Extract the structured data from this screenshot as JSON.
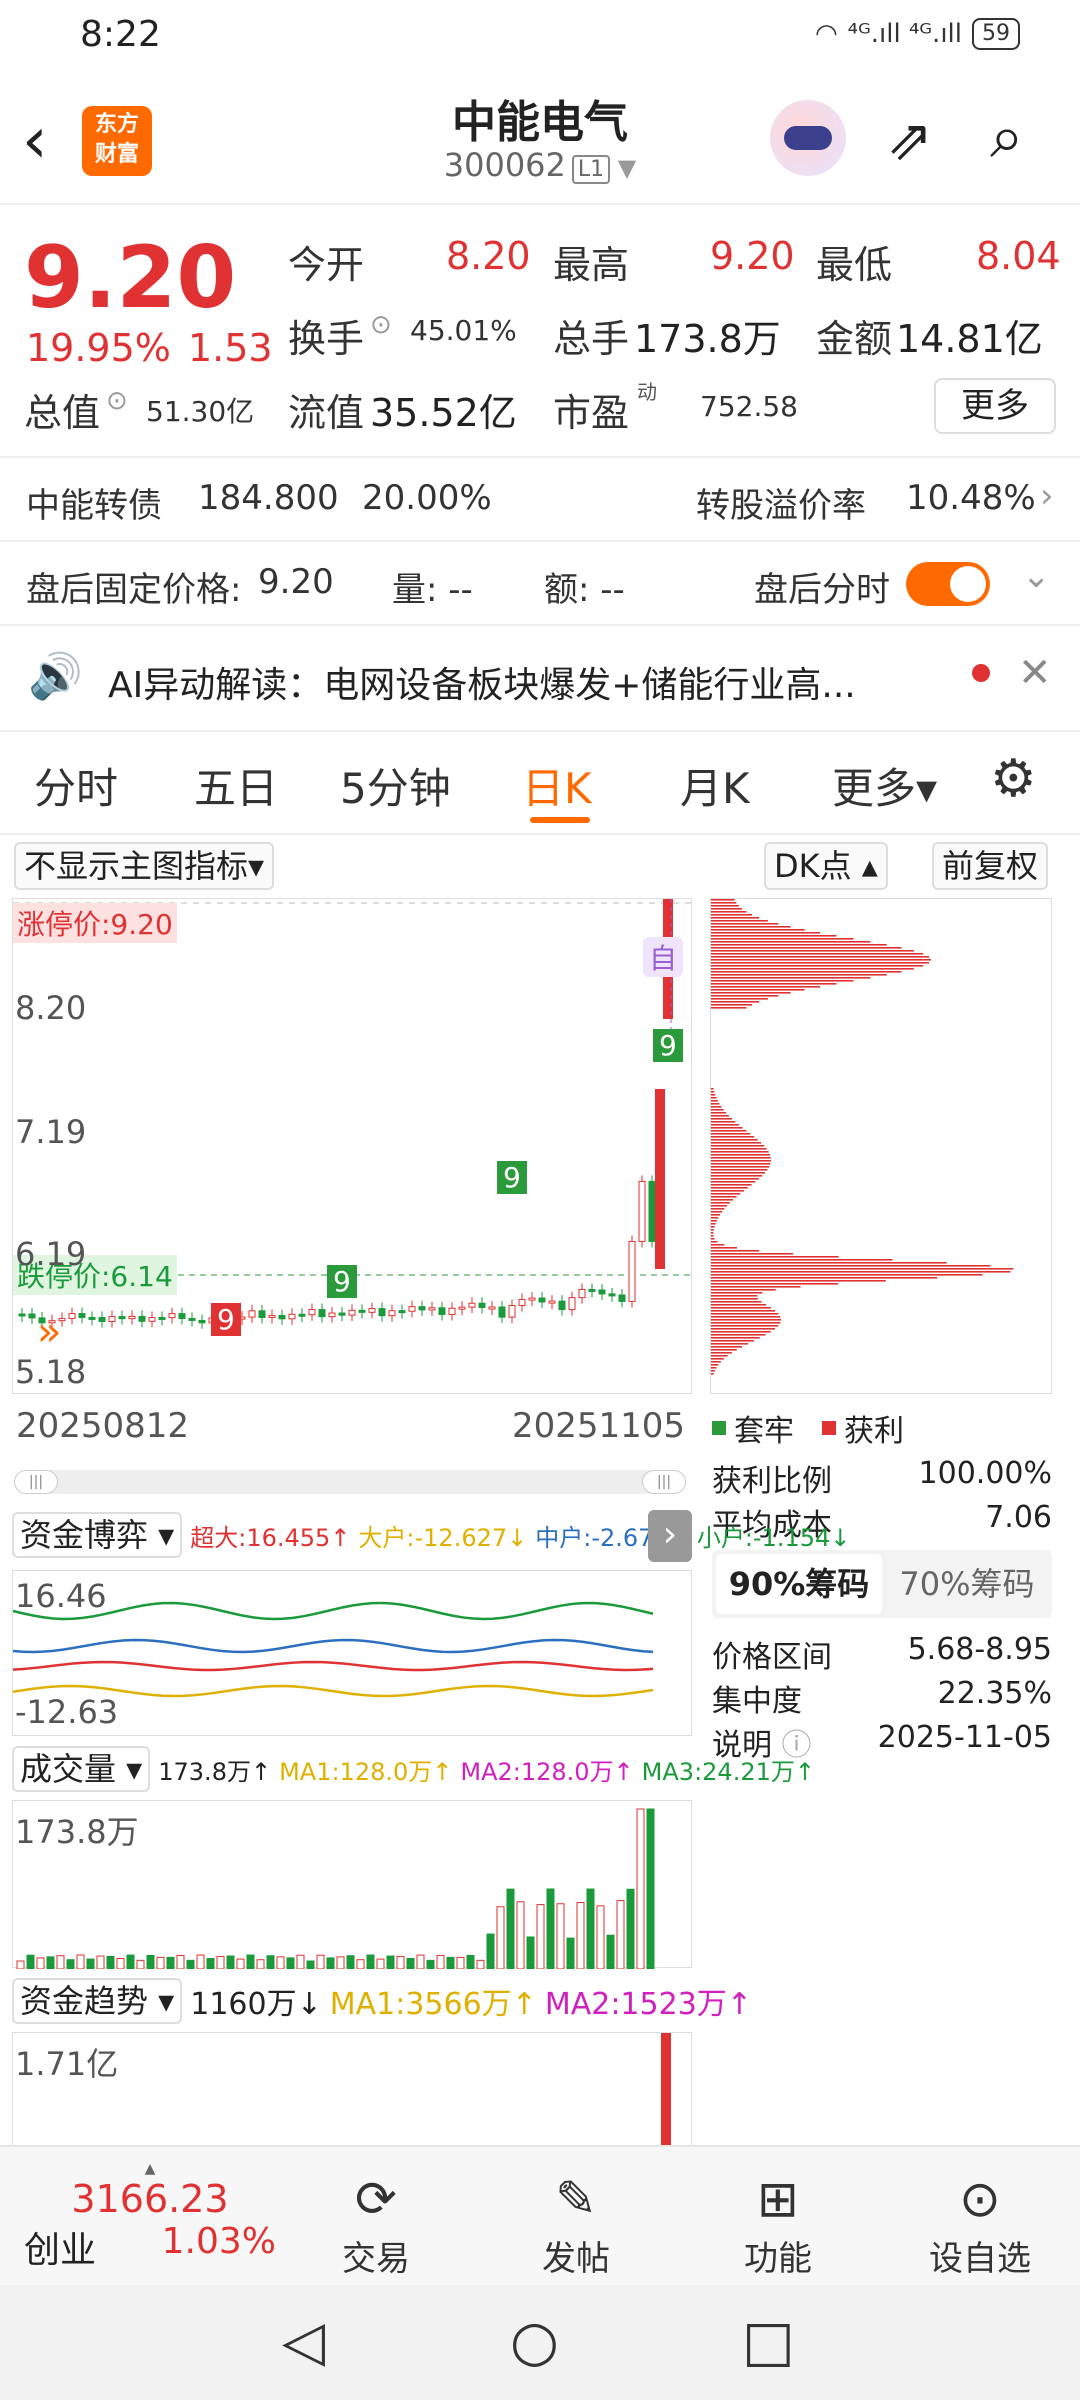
{
  "status_bar": {
    "time": "8:22",
    "signal": "⁴ᴳ.ıll ⁴ᴳ.ıll",
    "battery": "59"
  },
  "header": {
    "stock_name": "中能电气",
    "stock_code": "300062",
    "level": "L1",
    "logo_line1": "东方",
    "logo_line2": "财富"
  },
  "quote": {
    "price": "9.20",
    "change_pct": "19.95%",
    "change": "1.53",
    "open_label": "今开",
    "open": "8.20",
    "high_label": "最高",
    "high": "9.20",
    "low_label": "最低",
    "low": "8.04",
    "turnover_label": "换手",
    "turnover": "45.01%",
    "volume_label": "总手",
    "volume": "173.8万",
    "amount_label": "金额",
    "amount": "14.81亿",
    "mktcap_label": "总值",
    "mktcap": "51.30亿",
    "float_label": "流值",
    "float": "35.52亿",
    "pe_label": "市盈",
    "pe_sup": "动",
    "pe": "752.58",
    "more": "更多"
  },
  "bond": {
    "label": "中能转债",
    "price": "184.800",
    "pct": "20.00%",
    "premium_label": "转股溢价率",
    "premium": "10.48%"
  },
  "after_hours": {
    "label": "盘后固定价格:",
    "price": "9.20",
    "vol_label": "量: --",
    "amt_label": "额: --",
    "toggle_label": "盘后分时"
  },
  "ai_banner": {
    "text": "AI异动解读：电网设备板块爆发+储能行业高..."
  },
  "tabs": [
    "分时",
    "五日",
    "5分钟",
    "日K",
    "月K",
    "更多▾"
  ],
  "chart_controls": {
    "indicator": "不显示主图指标▾",
    "dk": "DK点 ▴",
    "adjust": "前复权"
  },
  "kline": {
    "limit_up": "涨停价:9.20",
    "limit_down": "跌停价:6.14",
    "y_labels": [
      "8.20",
      "7.19",
      "6.19",
      "5.18"
    ],
    "start_date": "20250812",
    "end_date": "20251105",
    "marker": "自"
  },
  "chip_panel": {
    "legend_trap": "套牢",
    "legend_profit": "获利",
    "rows": [
      {
        "label": "获利比例",
        "value": "100.00%"
      },
      {
        "label": "平均成本",
        "value": "7.06"
      }
    ],
    "tab_90": "90%筹码",
    "tab_70": "70%筹码",
    "rows2": [
      {
        "label": "价格区间",
        "value": "5.68-8.95"
      },
      {
        "label": "集中度",
        "value": "22.35%"
      },
      {
        "label": "说明",
        "value": "2025-11-05"
      }
    ]
  },
  "fund_game": {
    "label": "资金博弈 ▾",
    "super": "超大:16.455↑",
    "big": "大户:-12.627↓",
    "mid": "中户:-2.675↑",
    "small": "小户:-1.154↓",
    "max": "16.46",
    "min": "-12.63"
  },
  "volume": {
    "label": "成交量 ▾",
    "vol": "173.8万↑",
    "ma1": "MA1:128.0万↑",
    "ma2": "MA2:128.0万↑",
    "ma3": "MA3:24.21万↑",
    "max": "173.8万"
  },
  "fund_trend": {
    "label": "资金趋势 ▾",
    "val": "1160万↓",
    "ma1": "MA1:3566万↑",
    "ma2": "MA2:1523万↑",
    "max": "1.71亿"
  },
  "bottom_bar": {
    "index_value": "3166.23",
    "index_name": "创业",
    "index_pct": "1.03%",
    "items": [
      "交易",
      "发帖",
      "功能",
      "设自选"
    ]
  },
  "colors": {
    "up": "#e03232",
    "down": "#1a9a3a",
    "accent": "#ff6a00"
  }
}
